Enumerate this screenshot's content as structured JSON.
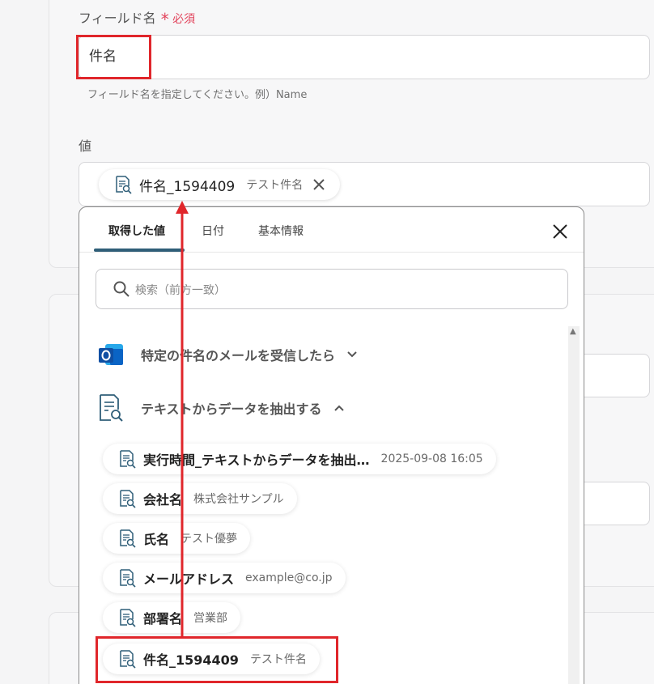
{
  "field": {
    "label": "フィールド名",
    "required_star": "*",
    "required_label": "必須",
    "value": "件名",
    "hint": "フィールド名を指定してください。例）Name"
  },
  "value_section": {
    "label": "値",
    "chip": {
      "name": "件名_1594409",
      "value": "テスト件名"
    }
  },
  "dropdown": {
    "tabs": [
      {
        "label": "取得した値"
      },
      {
        "label": "日付"
      },
      {
        "label": "基本情報"
      }
    ],
    "search_placeholder": "検索（前方一致）",
    "sections": [
      {
        "label": "特定の件名のメールを受信したら",
        "icon": "outlook-icon",
        "expanded": false
      },
      {
        "label": "テキストからデータを抽出する",
        "icon": "document-search-icon",
        "expanded": true
      }
    ],
    "items": [
      {
        "name": "実行時間_テキストからデータを抽出…",
        "value": "2025-09-08 16:05"
      },
      {
        "name": "会社名",
        "value": "株式会社サンプル"
      },
      {
        "name": "氏名",
        "value": "テスト優夢"
      },
      {
        "name": "メールアドレス",
        "value": "example@co.jp"
      },
      {
        "name": "部署名",
        "value": "営業部"
      },
      {
        "name": "件名_1594409",
        "value": "テスト件名"
      }
    ]
  },
  "colors": {
    "accent": "#2f5e78",
    "highlight": "#e0262b",
    "required": "#e2445c",
    "outlook_blue": "#0a64c5"
  }
}
